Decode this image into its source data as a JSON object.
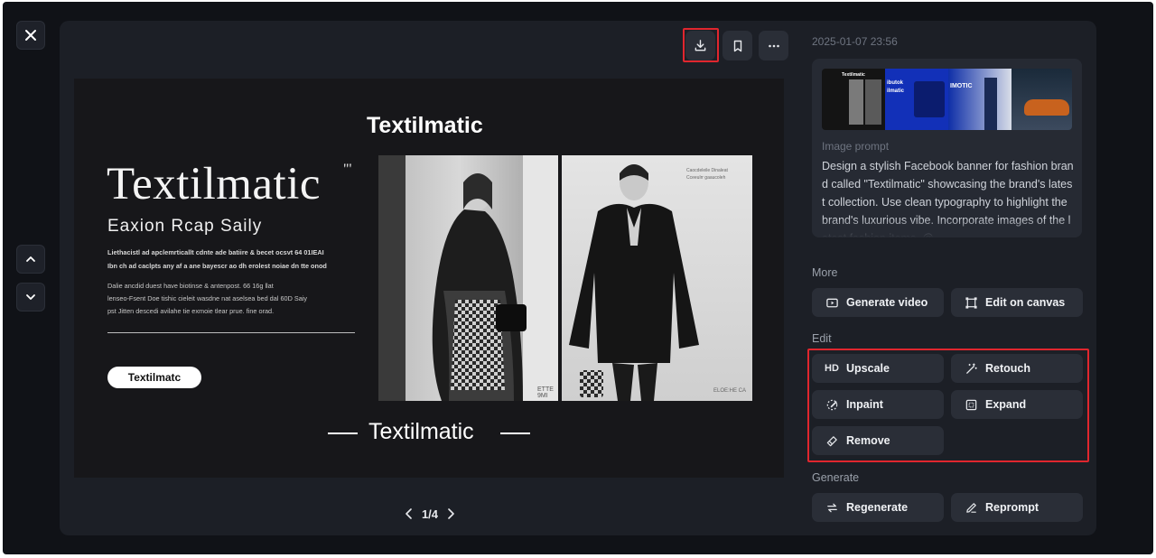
{
  "header": {
    "timestamp": "2025-01-07 23:56",
    "pager": {
      "current_total": "1/4"
    }
  },
  "toolbar": {
    "download_icon": "download-icon",
    "bookmark_icon": "bookmark-icon",
    "more_icon": "more-icon"
  },
  "image": {
    "brand_top": "Textilmatic",
    "brand_large": "Textilmatic",
    "brand_mark": "\"'",
    "subheading": "Eaxion Rcap Saily",
    "para1_line1": "Liethacistl ad apclemrticallt cdnte ade batiire & becet ocsvt 64 01IEAI",
    "para1_line2": "Ibn ch ad caclpts any af a ane bayescr ao dh erolest noiae dn tte onod",
    "para2_line1": "Dalie ancdid duest have biotinse & antenpost.  66 16g llat",
    "para2_line2": "lenseo-Fsent Doe tishic cieleit wasdne nat aselsea bed dal 60D Saiy",
    "para2_line3": "pst Jitten descedi avilahe tie exmoie tlear prue. fine orad.",
    "pill_label": "Textilmatc",
    "brand_bottom": "Textilmatic",
    "photo_caption_small": "Caocdeleile Dinaleat",
    "photo_caption_small2": "Cceeulrr gaaucoleh",
    "photo_stamp": "ETTE 9MI",
    "photo_stamp2": "ELOE:HE CA"
  },
  "prompt": {
    "label": "Image prompt",
    "text": "Design a stylish Facebook banner for fashion brand called \"Textilmatic\" showcasing the brand's latest collection. Use clean typography to highlight the brand's luxurious vibe. Incorporate images of the latest fashion items. @"
  },
  "thumbnails": {
    "t1_title": "Textilmatic",
    "t2_title": "ibutok ilmatic",
    "t3_title": "IMOTIC"
  },
  "sections": {
    "more": "More",
    "edit": "Edit",
    "generate": "Generate"
  },
  "buttons": {
    "generate_video": "Generate video",
    "edit_on_canvas": "Edit on canvas",
    "upscale": "Upscale",
    "upscale_icon_text": "HD",
    "retouch": "Retouch",
    "inpaint": "Inpaint",
    "expand": "Expand",
    "remove": "Remove",
    "regenerate": "Regenerate",
    "reprompt": "Reprompt"
  },
  "colors": {
    "accent_highlight": "#e0262e",
    "panel_bg": "#1c1f26",
    "button_bg": "#2a2e37"
  }
}
